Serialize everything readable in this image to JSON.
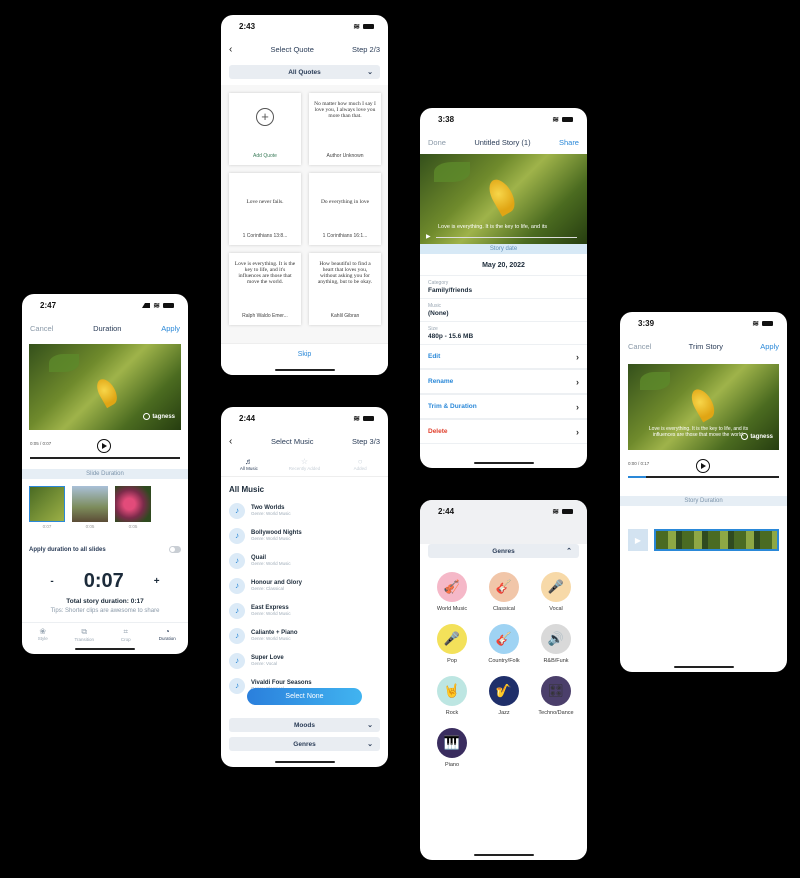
{
  "colors": {
    "accent": "#2a88d8",
    "delete": "#e0402d",
    "strip_bg": "#e6eef5"
  },
  "quote_screen": {
    "time": "2:43",
    "title": "Select Quote",
    "step": "Step 2/3",
    "filter": "All Quotes",
    "add_label": "Add Quote",
    "quotes": [
      {
        "text": "No matter how much I say I love you, I always love you more than that.",
        "author": "Author Unknown"
      },
      {
        "text": "Love never fails.",
        "author": "1 Corinthians 13:8..."
      },
      {
        "text": "Do everything in love",
        "author": "1 Corinthians 16:1..."
      },
      {
        "text": "Love is everything. It is the key to life, and it's influences are those that move the world.",
        "author": "Ralph Waldo Emer..."
      },
      {
        "text": "How beautiful to find a heart that loves you, without asking you for anything, but to be okay.",
        "author": "Kahlil Gibran"
      }
    ],
    "skip": "Skip"
  },
  "duration_screen": {
    "time": "2:47",
    "cancel": "Cancel",
    "title": "Duration",
    "apply": "Apply",
    "watermark": "tagness",
    "time_readout": "0:05 / 0:07",
    "strip": "Slide Duration",
    "thumbs": [
      "0:07",
      "0:05",
      "0:05"
    ],
    "apply_all": "Apply duration to all slides",
    "minus": "-",
    "value": "0:07",
    "plus": "+",
    "total": "Total story duration: 0:17",
    "tip": "Tips: Shorter clips are awesome to share",
    "tabs": [
      "Style",
      "Transition",
      "Crop",
      "Duration"
    ]
  },
  "music_screen": {
    "time": "2:44",
    "title": "Select Music",
    "step": "Step 3/3",
    "tabs": [
      "All Music",
      "Recently Added",
      "Added"
    ],
    "heading": "All Music",
    "tracks": [
      {
        "name": "Two Worlds",
        "genre": "Genre: World Music"
      },
      {
        "name": "Bollywood Nights",
        "genre": "Genre: World Music"
      },
      {
        "name": "Quail",
        "genre": "Genre: World Music"
      },
      {
        "name": "Honour and Glory",
        "genre": "Genre: Classical"
      },
      {
        "name": "East Express",
        "genre": "Genre: World Music"
      },
      {
        "name": "Caliante + Piano",
        "genre": "Genre: World Music"
      },
      {
        "name": "Super Love",
        "genre": "Genre: Vocal"
      },
      {
        "name": "Vivaldi Four Seasons",
        "genre": "Genre: Classical"
      }
    ],
    "select_none": "Select None",
    "moods": "Moods",
    "genres": "Genres"
  },
  "story_screen": {
    "time": "3:38",
    "done": "Done",
    "title": "Untitled Story (1)",
    "share": "Share",
    "caption": "Love is everything. It is the key to life, and its",
    "strip": "Story date",
    "date": "May 20, 2022",
    "fields": [
      {
        "label": "Category",
        "value": "Family/friends"
      },
      {
        "label": "Music",
        "value": "(None)"
      },
      {
        "label": "Size",
        "value": "480p - 15.6 MB"
      }
    ],
    "actions": [
      "Edit",
      "Rename",
      "Trim & Duration",
      "Delete"
    ]
  },
  "genres_screen": {
    "time": "2:44",
    "header": "Genres",
    "genres": [
      {
        "name": "World Music",
        "icon": "🎻",
        "color": "#f5b8c8"
      },
      {
        "name": "Classical",
        "icon": "🎸",
        "color": "#f1c6a9"
      },
      {
        "name": "Vocal",
        "icon": "🎤",
        "color": "#f7d9a8"
      },
      {
        "name": "Pop",
        "icon": "🎤",
        "color": "#f3e15a"
      },
      {
        "name": "Country/Folk",
        "icon": "🎸",
        "color": "#9fd3f3"
      },
      {
        "name": "R&B/Funk",
        "icon": "🔊",
        "color": "#d9d9d9"
      },
      {
        "name": "Rock",
        "icon": "🤘",
        "color": "#bde6e2"
      },
      {
        "name": "Jazz",
        "icon": "🎷",
        "color": "#1f2f6a"
      },
      {
        "name": "Techno/Dance",
        "icon": "🎛",
        "color": "#4b3f6b"
      },
      {
        "name": "Piano",
        "icon": "🎹",
        "color": "#3a2d5f"
      }
    ]
  },
  "trim_screen": {
    "time": "3:39",
    "cancel": "Cancel",
    "title": "Trim Story",
    "apply": "Apply",
    "caption": "Love is everything. It is the key to life, and its influences are those that move the world.",
    "watermark": "tagness",
    "time_readout": "0:00 / 0:17",
    "strip": "Story Duration"
  }
}
